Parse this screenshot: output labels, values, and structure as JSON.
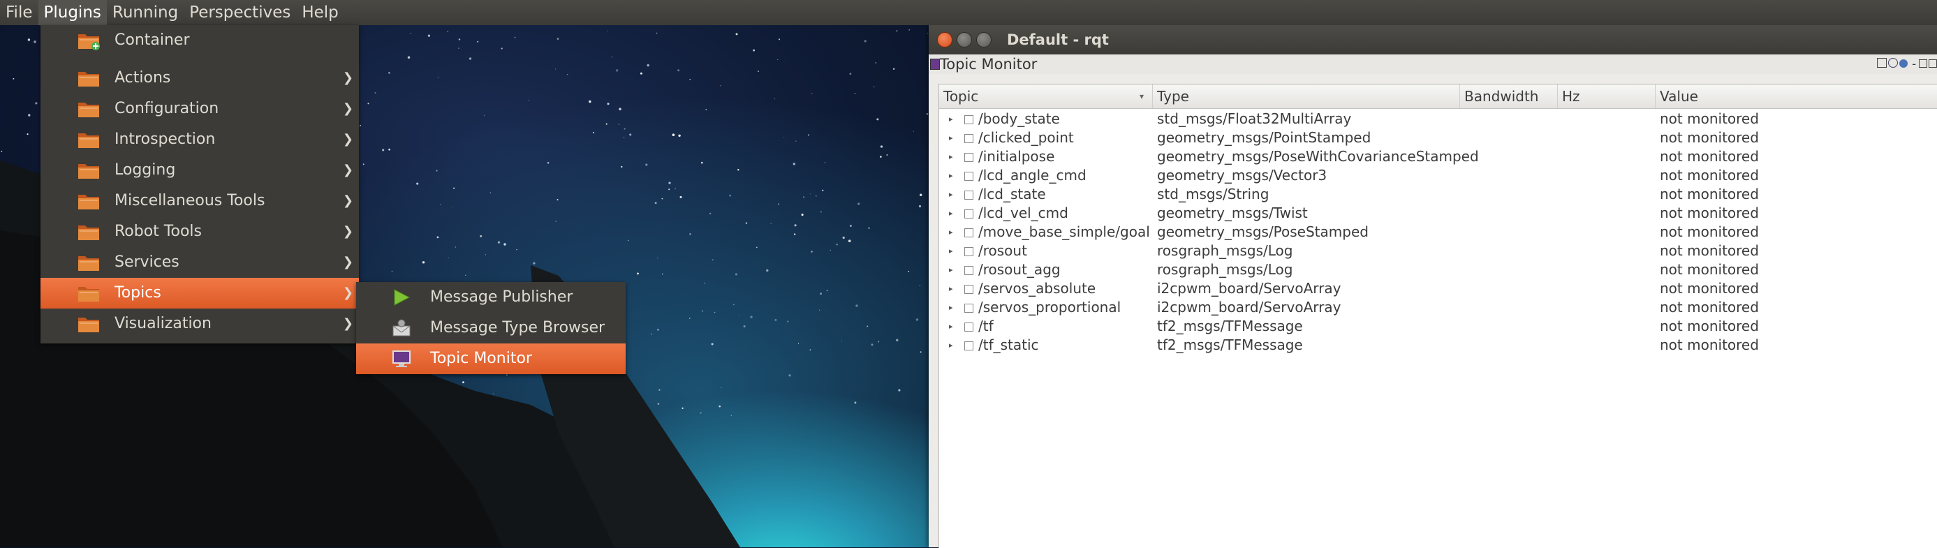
{
  "menubar": {
    "items": [
      "File",
      "Plugins",
      "Running",
      "Perspectives",
      "Help"
    ],
    "active": "Plugins"
  },
  "plugins_menu": {
    "items": [
      {
        "label": "Container",
        "submenu": false,
        "icon": "folder-add-icon"
      },
      {
        "label": "Actions",
        "submenu": true,
        "icon": "folder-icon"
      },
      {
        "label": "Configuration",
        "submenu": true,
        "icon": "folder-icon"
      },
      {
        "label": "Introspection",
        "submenu": true,
        "icon": "folder-icon"
      },
      {
        "label": "Logging",
        "submenu": true,
        "icon": "folder-icon"
      },
      {
        "label": "Miscellaneous Tools",
        "submenu": true,
        "icon": "folder-icon"
      },
      {
        "label": "Robot Tools",
        "submenu": true,
        "icon": "folder-icon"
      },
      {
        "label": "Services",
        "submenu": true,
        "icon": "folder-icon"
      },
      {
        "label": "Topics",
        "submenu": true,
        "icon": "folder-icon",
        "highlighted": true
      },
      {
        "label": "Visualization",
        "submenu": true,
        "icon": "folder-icon"
      }
    ],
    "arrow_glyph": "❯"
  },
  "topics_submenu": {
    "items": [
      {
        "label": "Message Publisher",
        "icon": "play-icon"
      },
      {
        "label": "Message Type Browser",
        "icon": "envelope-icon"
      },
      {
        "label": "Topic Monitor",
        "icon": "monitor-icon",
        "highlighted": true
      }
    ]
  },
  "window": {
    "title": "Default - rqt",
    "buttons": {
      "close": "×",
      "minimize": "–",
      "maximize": "□"
    },
    "plugin_title": "Topic Monitor",
    "plugin_tools": "D C ? - O ×"
  },
  "table": {
    "headers": [
      "Topic",
      "Type",
      "Bandwidth",
      "Hz",
      "Value"
    ],
    "sort_indicator": "▾",
    "rows": [
      {
        "topic": "/body_state",
        "type": "std_msgs/Float32MultiArray",
        "value": "not monitored"
      },
      {
        "topic": "/clicked_point",
        "type": "geometry_msgs/PointStamped",
        "value": "not monitored"
      },
      {
        "topic": "/initialpose",
        "type": "geometry_msgs/PoseWithCovarianceStamped",
        "value": "not monitored"
      },
      {
        "topic": "/lcd_angle_cmd",
        "type": "geometry_msgs/Vector3",
        "value": "not monitored"
      },
      {
        "topic": "/lcd_state",
        "type": "std_msgs/String",
        "value": "not monitored"
      },
      {
        "topic": "/lcd_vel_cmd",
        "type": "geometry_msgs/Twist",
        "value": "not monitored"
      },
      {
        "topic": "/move_base_simple/goal",
        "type": "geometry_msgs/PoseStamped",
        "value": "not monitored"
      },
      {
        "topic": "/rosout",
        "type": "rosgraph_msgs/Log",
        "value": "not monitored"
      },
      {
        "topic": "/rosout_agg",
        "type": "rosgraph_msgs/Log",
        "value": "not monitored"
      },
      {
        "topic": "/servos_absolute",
        "type": "i2cpwm_board/ServoArray",
        "value": "not monitored"
      },
      {
        "topic": "/servos_proportional",
        "type": "i2cpwm_board/ServoArray",
        "value": "not monitored"
      },
      {
        "topic": "/tf",
        "type": "tf2_msgs/TFMessage",
        "value": "not monitored"
      },
      {
        "topic": "/tf_static",
        "type": "tf2_msgs/TFMessage",
        "value": "not monitored"
      }
    ]
  },
  "colors": {
    "accent": "#e8662f",
    "menu_bg": "#3c3b37",
    "close_button": "#e8562a",
    "folder": "#e0792f"
  }
}
